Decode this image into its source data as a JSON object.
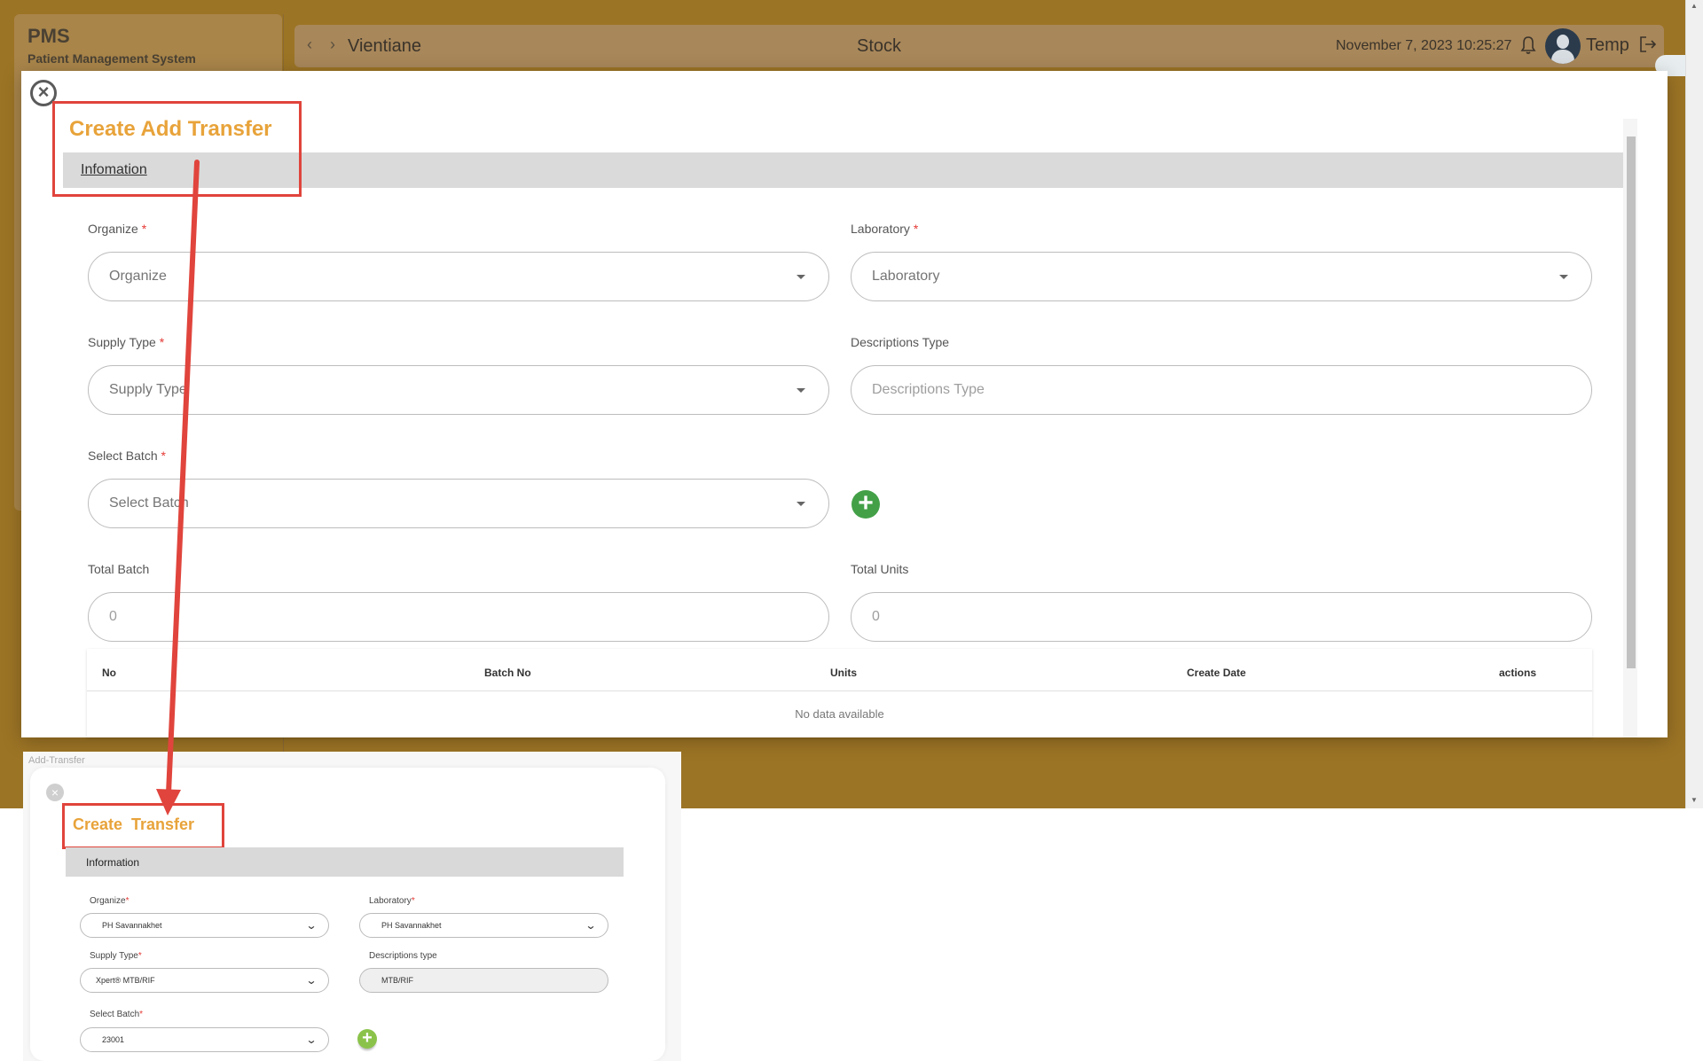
{
  "app": {
    "brand_title": "PMS",
    "brand_subtitle": "Patient Management System",
    "location": "Vientiane",
    "page_heading": "Stock",
    "datetime": "November 7, 2023 10:25:27",
    "username": "Temp"
  },
  "dialog": {
    "title": "Create Add Transfer",
    "tab": "Infomation",
    "fields": {
      "organize": {
        "label": "Organize",
        "required": "*",
        "placeholder": "Organize"
      },
      "laboratory": {
        "label": "Laboratory",
        "required": "*",
        "placeholder": "Laboratory"
      },
      "supply_type": {
        "label": "Supply Type",
        "required": "*",
        "placeholder": "Supply Type"
      },
      "descriptions_type": {
        "label": "Descriptions Type",
        "placeholder": "Descriptions Type"
      },
      "select_batch": {
        "label": "Select Batch",
        "required": "*",
        "placeholder": "Select Batch"
      },
      "total_batch": {
        "label": "Total Batch",
        "value": "0"
      },
      "total_units": {
        "label": "Total Units",
        "value": "0"
      }
    },
    "table": {
      "headers": [
        "No",
        "Batch No",
        "Units",
        "Create Date",
        "actions"
      ],
      "empty": "No data available"
    }
  },
  "inset": {
    "tag": "Add-Transfer",
    "title": "Create  Transfer",
    "tab": "Information",
    "fields": {
      "organize": {
        "label": "Organize",
        "required": "*",
        "value": "PH Savannakhet"
      },
      "laboratory": {
        "label": "Laboratory",
        "required": "*",
        "value": "PH Savannakhet"
      },
      "supply_type": {
        "label": "Supply Type",
        "required": "*",
        "value": "Xpert® MTB/RIF"
      },
      "descriptions_type": {
        "label": "Descriptions type",
        "value": "MTB/RIF"
      },
      "select_batch": {
        "label": "Select Batch",
        "required": "*",
        "value": "23001"
      }
    }
  },
  "colors": {
    "app_background": "#9c7425",
    "title_accent": "#e8a33a",
    "annotation": "#e0443c",
    "add_button": "#43a047"
  },
  "icons": [
    "chevron-left-icon",
    "chevron-right-icon",
    "bell-icon",
    "avatar",
    "logout-icon",
    "close-icon",
    "caret-down-icon",
    "plus-icon",
    "arrow-annotation"
  ]
}
